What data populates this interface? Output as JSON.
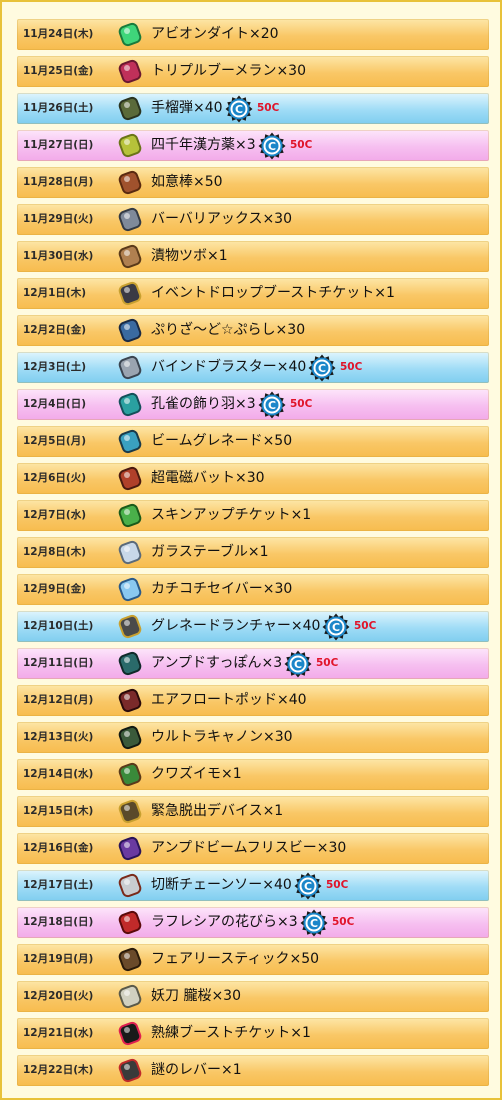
{
  "colors": {
    "weekday_row": "#f9c766",
    "saturday_row": "#9fdcf6",
    "sunday_row": "#f6bff0",
    "price": "#e0142a",
    "coin_blue": "#1b86c9"
  },
  "rows": [
    {
      "date": "11月24日(木)",
      "item": "アビオンダイト×20",
      "type": "normal",
      "price": "",
      "icon": "gem-icon"
    },
    {
      "date": "11月25日(金)",
      "item": "トリプルブーメラン×30",
      "type": "normal",
      "price": "",
      "icon": "boomerang-icon"
    },
    {
      "date": "11月26日(土)",
      "item": "手榴弾×40",
      "type": "sat",
      "price": "50C",
      "icon": "grenade-icon"
    },
    {
      "date": "11月27日(日)",
      "item": "四千年漢方薬×3",
      "type": "sun",
      "price": "50C",
      "icon": "herb-medicine-icon"
    },
    {
      "date": "11月28日(月)",
      "item": "如意棒×50",
      "type": "normal",
      "price": "",
      "icon": "staff-icon"
    },
    {
      "date": "11月29日(火)",
      "item": "バーバリアックス×30",
      "type": "normal",
      "price": "",
      "icon": "axe-icon"
    },
    {
      "date": "11月30日(水)",
      "item": "漬物ツボ×1",
      "type": "normal",
      "price": "",
      "icon": "pot-icon"
    },
    {
      "date": "12月1日(木)",
      "item": "イベントドロップブーストチケット×1",
      "type": "normal",
      "price": "",
      "icon": "ticket-icon"
    },
    {
      "date": "12月2日(金)",
      "item": "ぷりざ～ど☆ぷらし×30",
      "type": "normal",
      "price": "",
      "icon": "brush-icon"
    },
    {
      "date": "12月3日(土)",
      "item": "バインドブラスター×40",
      "type": "sat",
      "price": "50C",
      "icon": "blaster-icon"
    },
    {
      "date": "12月4日(日)",
      "item": "孔雀の飾り羽×3",
      "type": "sun",
      "price": "50C",
      "icon": "feather-icon"
    },
    {
      "date": "12月5日(月)",
      "item": "ビームグレネード×50",
      "type": "normal",
      "price": "",
      "icon": "beam-grenade-icon"
    },
    {
      "date": "12月6日(火)",
      "item": "超電磁バット×30",
      "type": "normal",
      "price": "",
      "icon": "bat-icon"
    },
    {
      "date": "12月7日(水)",
      "item": "スキンアップチケット×1",
      "type": "normal",
      "price": "",
      "icon": "skin-ticket-icon"
    },
    {
      "date": "12月8日(木)",
      "item": "ガラステーブル×1",
      "type": "normal",
      "price": "",
      "icon": "table-icon"
    },
    {
      "date": "12月9日(金)",
      "item": "カチコチセイバー×30",
      "type": "normal",
      "price": "",
      "icon": "saber-icon"
    },
    {
      "date": "12月10日(土)",
      "item": "グレネードランチャー×40",
      "type": "sat",
      "price": "50C",
      "icon": "launcher-icon"
    },
    {
      "date": "12月11日(日)",
      "item": "アンプドすっぽん×3",
      "type": "sun",
      "price": "50C",
      "icon": "turtle-icon"
    },
    {
      "date": "12月12日(月)",
      "item": "エアフロートポッド×40",
      "type": "normal",
      "price": "",
      "icon": "pod-icon"
    },
    {
      "date": "12月13日(火)",
      "item": "ウルトラキャノン×30",
      "type": "normal",
      "price": "",
      "icon": "cannon-icon"
    },
    {
      "date": "12月14日(水)",
      "item": "クワズイモ×1",
      "type": "normal",
      "price": "",
      "icon": "plant-icon"
    },
    {
      "date": "12月15日(木)",
      "item": "緊急脱出デバイス×1",
      "type": "normal",
      "price": "",
      "icon": "device-icon"
    },
    {
      "date": "12月16日(金)",
      "item": "アンプドビームフリスビー×30",
      "type": "normal",
      "price": "",
      "icon": "frisbee-icon"
    },
    {
      "date": "12月17日(土)",
      "item": "切断チェーンソー×40",
      "type": "sat",
      "price": "50C",
      "icon": "chainsaw-icon"
    },
    {
      "date": "12月18日(日)",
      "item": "ラフレシアの花びら×3",
      "type": "sun",
      "price": "50C",
      "icon": "petal-icon"
    },
    {
      "date": "12月19日(月)",
      "item": "フェアリースティック×50",
      "type": "normal",
      "price": "",
      "icon": "wand-icon"
    },
    {
      "date": "12月20日(火)",
      "item": "妖刀 朧桜×30",
      "type": "normal",
      "price": "",
      "icon": "katana-icon"
    },
    {
      "date": "12月21日(水)",
      "item": "熟練ブーストチケット×1",
      "type": "normal",
      "price": "",
      "icon": "boost-ticket-icon"
    },
    {
      "date": "12月22日(木)",
      "item": "謎のレバー×1",
      "type": "normal",
      "price": "",
      "icon": "lever-icon"
    }
  ]
}
